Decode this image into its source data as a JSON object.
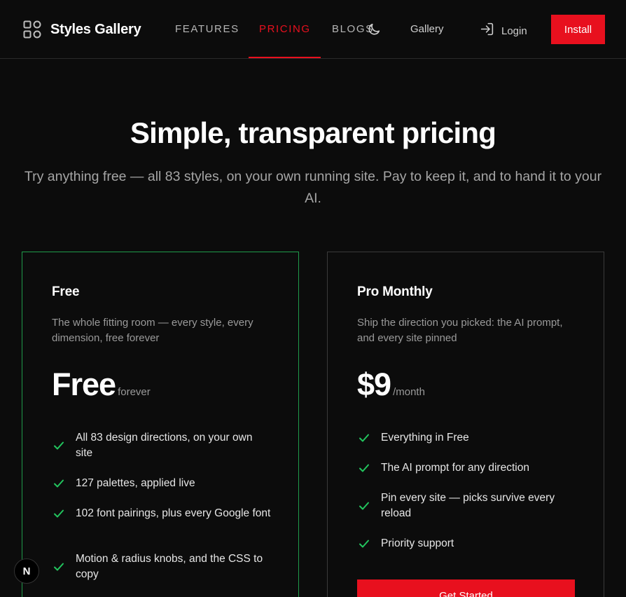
{
  "header": {
    "logo_text": "Styles Gallery",
    "nav": [
      "FEATURES",
      "PRICING",
      "BLOGS"
    ],
    "active_nav": "PRICING",
    "gallery": "Gallery",
    "login": "Login",
    "install": "Install"
  },
  "hero": {
    "title": "Simple, transparent pricing",
    "subtitle": "Try anything free — all 83 styles, on your own running site. Pay to keep it, and to hand it to your AI."
  },
  "plans": [
    {
      "name": "Free",
      "description": "The whole fitting room — every style, every dimension, free forever",
      "price": "Free",
      "period": "forever",
      "features": [
        "All 83 design directions, on your own site",
        "127 palettes, applied live",
        "102 font pairings, plus every Google font",
        "Motion & radius knobs, and the CSS to copy"
      ]
    },
    {
      "name": "Pro Monthly",
      "description": "Ship the direction you picked: the AI prompt, and every site pinned",
      "price": "$9",
      "period": "/month",
      "features": [
        "Everything in Free",
        "The AI prompt for any direction",
        "Pin every site — picks survive every reload",
        "Priority support"
      ],
      "cta": "Get Started"
    }
  ],
  "badge": "N",
  "colors": {
    "accent": "#e8101e",
    "check": "#22c55e",
    "free_border": "#1f9b4a",
    "background": "#0c0c0c"
  },
  "icons": [
    "logo-grid-icon",
    "moon-icon",
    "login-icon",
    "check-icon"
  ]
}
